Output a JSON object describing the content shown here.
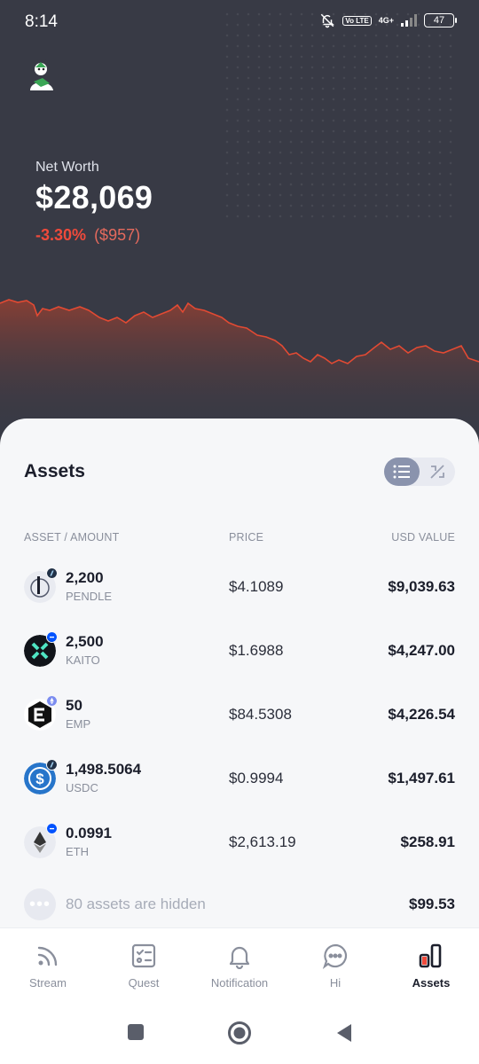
{
  "status_bar": {
    "time": "8:14",
    "volte": "Vo LTE",
    "network": "4G+",
    "battery": "47"
  },
  "header": {
    "avatar_icon": "user-avatar-icon"
  },
  "net_worth": {
    "label": "Net Worth",
    "value": "$28,069",
    "change_pct": "-3.30%",
    "change_abs": "($957)",
    "change_color": "#ef4a3b"
  },
  "assets": {
    "title": "Assets",
    "columns": {
      "asset": "ASSET / AMOUNT",
      "price": "PRICE",
      "usd": "USD VALUE"
    },
    "rows": [
      {
        "amount": "2,200",
        "symbol": "PENDLE",
        "price": "$4.1089",
        "usd": "$9,039.63",
        "icon": "pendle-icon",
        "chain": "arbitrum-badge-icon"
      },
      {
        "amount": "2,500",
        "symbol": "KAITO",
        "price": "$1.6988",
        "usd": "$4,247.00",
        "icon": "kaito-icon",
        "chain": "base-badge-icon"
      },
      {
        "amount": "50",
        "symbol": "EMP",
        "price": "$84.5308",
        "usd": "$4,226.54",
        "icon": "emp-icon",
        "chain": "ethereum-badge-icon"
      },
      {
        "amount": "1,498.5064",
        "symbol": "USDC",
        "price": "$0.9994",
        "usd": "$1,497.61",
        "icon": "usdc-icon",
        "chain": "arbitrum-badge-icon"
      },
      {
        "amount": "0.0991",
        "symbol": "ETH",
        "price": "$2,613.19",
        "usd": "$258.91",
        "icon": "eth-icon",
        "chain": "base-badge-icon"
      }
    ],
    "hidden": {
      "text": "80 assets are hidden",
      "usd": "$99.53"
    }
  },
  "tabbar": {
    "tabs": [
      {
        "label": "Stream",
        "icon": "rss-icon"
      },
      {
        "label": "Quest",
        "icon": "checklist-icon"
      },
      {
        "label": "Notification",
        "icon": "bell-icon"
      },
      {
        "label": "Hi",
        "icon": "chat-icon"
      },
      {
        "label": "Assets",
        "icon": "bar-chart-icon",
        "active": true
      }
    ]
  },
  "colors": {
    "header_bg": "#383a45",
    "negative": "#ef4a3b",
    "sheet_bg": "#f6f7f9"
  }
}
